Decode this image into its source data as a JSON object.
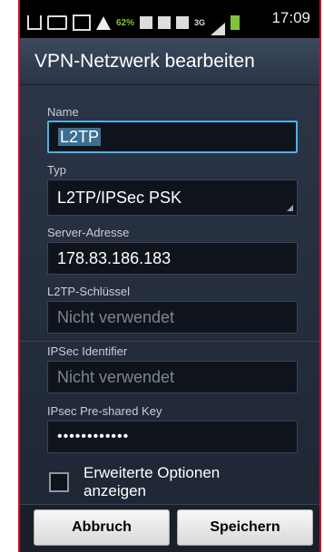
{
  "status_bar": {
    "battery_percent": "62%",
    "network": "3G",
    "time": "17:09"
  },
  "dialog": {
    "title": "VPN-Netzwerk bearbeiten",
    "fields": {
      "name": {
        "label": "Name",
        "value": "L2TP"
      },
      "type": {
        "label": "Typ",
        "value": "L2TP/IPSec PSK"
      },
      "server": {
        "label": "Server-Adresse",
        "value": "178.83.186.183"
      },
      "l2tp_secret": {
        "label": "L2TP-Schlüssel",
        "placeholder": "Nicht verwendet"
      },
      "ipsec_identifier": {
        "label": "IPSec Identifier",
        "placeholder": "Nicht verwendet"
      },
      "ipsec_psk": {
        "label": "IPsec Pre-shared Key",
        "value": "••••••••••••"
      }
    },
    "advanced_options": {
      "label": "Erweiterte Optionen anzeigen",
      "checked": false
    },
    "buttons": {
      "cancel": "Abbruch",
      "save": "Speichern"
    }
  },
  "colors": {
    "accent_focus": "#4ab3e6",
    "frame_red": "#c8102e",
    "battery_green": "#7fc43a"
  }
}
